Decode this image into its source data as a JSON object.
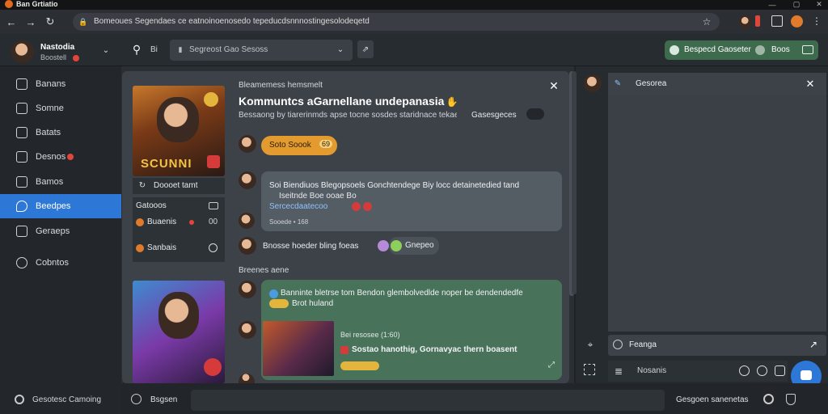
{
  "window": {
    "title": "Ban Grtiatio"
  },
  "browser": {
    "address": "Bomeoues Segendaes ce eatnoinoenosedo tepeducdsnnnostingesolodeqetd",
    "colors": {
      "accent": "#2d78d6",
      "green": "#48725a",
      "orange": "#e39a2e"
    }
  },
  "header": {
    "user_name": "Nastodia",
    "user_status": "Boostell",
    "search_placeholder": "Segreost Gao Sesoss",
    "search_prefix": "Bi",
    "action_label": "Bespecd Gaoseter",
    "action_right": "Boos"
  },
  "sidebar": {
    "items": [
      {
        "label": "Banans",
        "icon": "game-icon"
      },
      {
        "label": "Somne",
        "icon": "book-icon"
      },
      {
        "label": "Batats",
        "icon": "person-icon"
      },
      {
        "label": "Desnos",
        "icon": "bell-icon"
      },
      {
        "label": "Bamos",
        "icon": "list-icon"
      },
      {
        "label": "Beedpes",
        "icon": "chat-icon"
      },
      {
        "label": "Geraeps",
        "icon": "doc-icon"
      },
      {
        "label": "Cobntos",
        "icon": "settings-icon"
      }
    ],
    "footer": "Gesotesc Camoing"
  },
  "chat": {
    "subtitle": "Bleamemess hemsmelt",
    "title": "Kommuntcs aGarnellane undepanasia",
    "description": "Bessaong by tiarerinmds apse tocne sosdes staridnace tekaetss...",
    "dropdown_label": "Gasesgeces",
    "game1_label": "Scunni",
    "game1_caption": "Doooet tamt",
    "game1_section": "Gatooos",
    "game1_row1": "Buaenis",
    "game1_row1_count": "00",
    "game1_row2": "Sanbais",
    "join_button": "Soto Soook",
    "join_badge": "69",
    "msg1_text": "Soi Biendiuos   Blegopsoels Gonchtendege Biy locc detainetedied tand",
    "msg1_line2": "Iseitnde Boe ooae Bo",
    "msg1_link": "Sercecdaatecoo",
    "msg1_time": "Sooede • 168",
    "msg2_text": "Bnosse hoeder bling foeas",
    "msg2_reply": "Gnepeo",
    "section_label": "Breenes aene",
    "msg3_text": "Banninte bletrse tom Bendon glembolvedlde noper be dendendedfe",
    "msg3_line2": "Brot huland",
    "msg3_meta": "Bei resosee (1:60)",
    "msg3_caption": "Sostao hanothig, Gornavyac thern boasent"
  },
  "right": {
    "tab_label": "Gesorea",
    "input_label": "Feanga",
    "composer_placeholder": "Nosanis"
  },
  "bottom": {
    "left_label": "Bsgsen",
    "right_label": "Gesgoen sanenetas"
  }
}
